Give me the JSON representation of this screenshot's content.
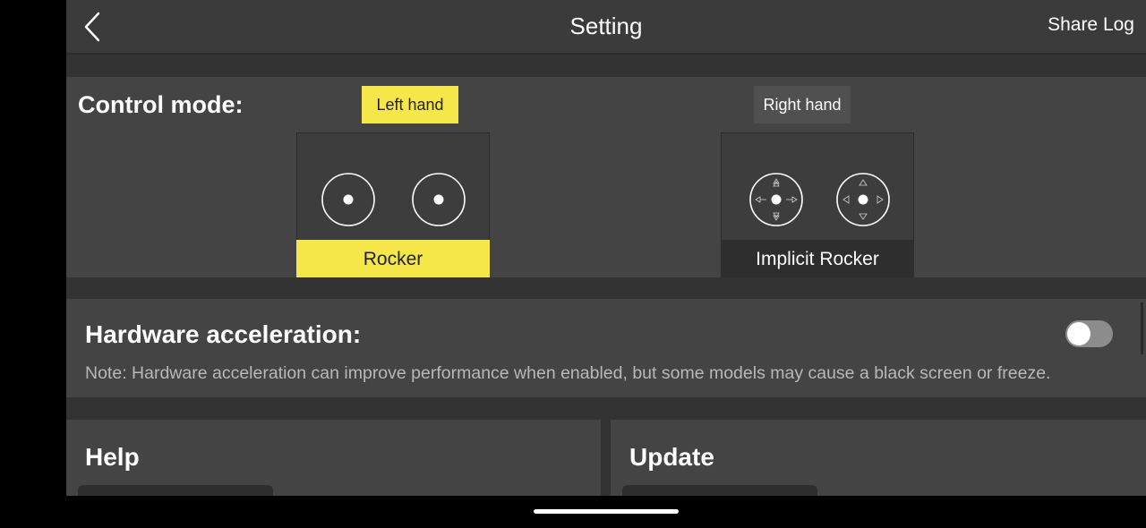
{
  "header": {
    "title": "Setting",
    "share_log": "Share Log"
  },
  "control_mode": {
    "label": "Control mode:",
    "hands": {
      "left": "Left hand",
      "right": "Right hand",
      "selected": "left"
    },
    "modes": {
      "rocker": "Rocker",
      "implicit_rocker": "Implicit Rocker",
      "selected": "rocker"
    }
  },
  "hardware_acceleration": {
    "title": "Hardware acceleration:",
    "note": "Note: Hardware acceleration can improve performance when enabled, but some models may cause a black screen or freeze.",
    "enabled": false
  },
  "help": {
    "title": "Help"
  },
  "update": {
    "title": "Update"
  },
  "colors": {
    "accent": "#f5e64a",
    "background": "#333333",
    "panel": "#444444"
  },
  "icons": {
    "back": "chevron-left-icon",
    "stick": "joystick-icon"
  }
}
